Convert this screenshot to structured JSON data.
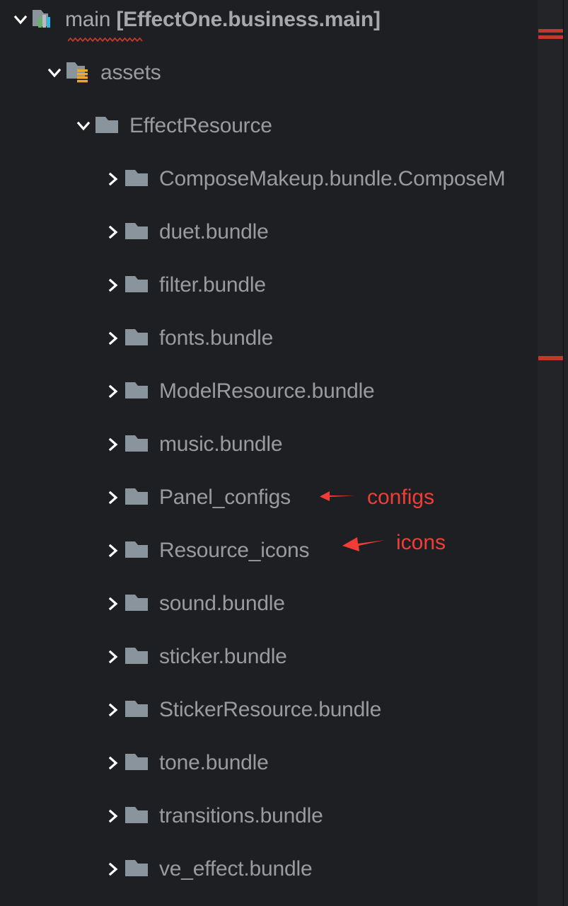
{
  "window": {
    "background_color": "#1e1f22",
    "panel_name": "project-tool-window"
  },
  "tree": {
    "root": {
      "label_plain": "main ",
      "label_bold": "[EffectOne.business.main]",
      "icon": "module-gradle-icon",
      "expanded": true,
      "has_error_underline": true
    },
    "items": [
      {
        "label": "assets",
        "icon": "resource-folder-icon",
        "expanded": true,
        "depth": 1,
        "chevron": "chevron-down-icon"
      },
      {
        "label": "EffectResource",
        "icon": "folder-icon",
        "expanded": true,
        "depth": 2,
        "chevron": "chevron-down-icon"
      },
      {
        "label": "ComposeMakeup.bundle.ComposeM",
        "icon": "folder-icon",
        "expanded": false,
        "depth": 3,
        "chevron": "chevron-right-icon",
        "truncated": true
      },
      {
        "label": "duet.bundle",
        "icon": "folder-icon",
        "expanded": false,
        "depth": 3,
        "chevron": "chevron-right-icon"
      },
      {
        "label": "filter.bundle",
        "icon": "folder-icon",
        "expanded": false,
        "depth": 3,
        "chevron": "chevron-right-icon"
      },
      {
        "label": "fonts.bundle",
        "icon": "folder-icon",
        "expanded": false,
        "depth": 3,
        "chevron": "chevron-right-icon"
      },
      {
        "label": "ModelResource.bundle",
        "icon": "folder-icon",
        "expanded": false,
        "depth": 3,
        "chevron": "chevron-right-icon"
      },
      {
        "label": "music.bundle",
        "icon": "folder-icon",
        "expanded": false,
        "depth": 3,
        "chevron": "chevron-right-icon"
      },
      {
        "label": "Panel_configs",
        "icon": "folder-icon",
        "expanded": false,
        "depth": 3,
        "chevron": "chevron-right-icon"
      },
      {
        "label": "Resource_icons",
        "icon": "folder-icon",
        "expanded": false,
        "depth": 3,
        "chevron": "chevron-right-icon"
      },
      {
        "label": "sound.bundle",
        "icon": "folder-icon",
        "expanded": false,
        "depth": 3,
        "chevron": "chevron-right-icon"
      },
      {
        "label": "sticker.bundle",
        "icon": "folder-icon",
        "expanded": false,
        "depth": 3,
        "chevron": "chevron-right-icon"
      },
      {
        "label": "StickerResource.bundle",
        "icon": "folder-icon",
        "expanded": false,
        "depth": 3,
        "chevron": "chevron-right-icon"
      },
      {
        "label": "tone.bundle",
        "icon": "folder-icon",
        "expanded": false,
        "depth": 3,
        "chevron": "chevron-right-icon"
      },
      {
        "label": "transitions.bundle",
        "icon": "folder-icon",
        "expanded": false,
        "depth": 3,
        "chevron": "chevron-right-icon"
      },
      {
        "label": "ve_effect.bundle",
        "icon": "folder-icon",
        "expanded": false,
        "depth": 3,
        "chevron": "chevron-right-icon"
      }
    ]
  },
  "annotations": {
    "color": "#f23d36",
    "items": [
      {
        "text": "configs",
        "arrow": "arrow-left-icon",
        "target": "Panel_configs"
      },
      {
        "text": "icons",
        "arrow": "arrow-left-icon",
        "target": "Resource_icons"
      }
    ]
  },
  "scrollbar": {
    "thumb_color": "#3b3552",
    "marker_color": "#c0392c",
    "marker_count": 3
  },
  "colors": {
    "background": "#1e1f22",
    "text": "#9a9b9d",
    "folder_icon": "#8a949c",
    "resource_stripe": "#f0a732",
    "accent_red": "#f23d36"
  }
}
